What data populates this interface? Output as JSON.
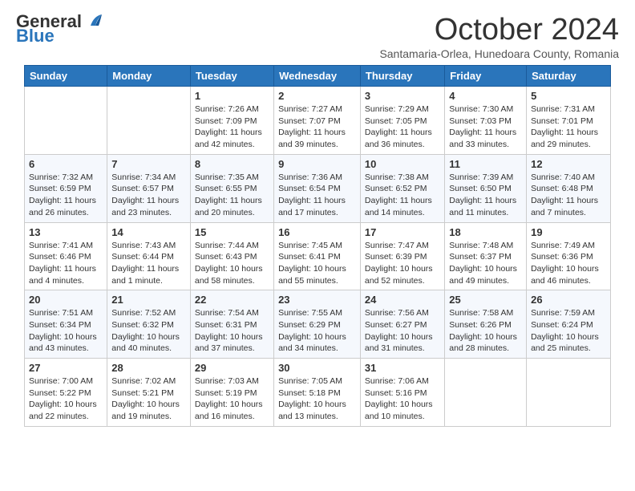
{
  "header": {
    "logo_general": "General",
    "logo_blue": "Blue",
    "title": "October 2024",
    "subtitle": "Santamaria-Orlea, Hunedoara County, Romania"
  },
  "days_of_week": [
    "Sunday",
    "Monday",
    "Tuesday",
    "Wednesday",
    "Thursday",
    "Friday",
    "Saturday"
  ],
  "weeks": [
    [
      {
        "day": "",
        "sunrise": "",
        "sunset": "",
        "daylight": ""
      },
      {
        "day": "",
        "sunrise": "",
        "sunset": "",
        "daylight": ""
      },
      {
        "day": "1",
        "sunrise": "Sunrise: 7:26 AM",
        "sunset": "Sunset: 7:09 PM",
        "daylight": "Daylight: 11 hours and 42 minutes."
      },
      {
        "day": "2",
        "sunrise": "Sunrise: 7:27 AM",
        "sunset": "Sunset: 7:07 PM",
        "daylight": "Daylight: 11 hours and 39 minutes."
      },
      {
        "day": "3",
        "sunrise": "Sunrise: 7:29 AM",
        "sunset": "Sunset: 7:05 PM",
        "daylight": "Daylight: 11 hours and 36 minutes."
      },
      {
        "day": "4",
        "sunrise": "Sunrise: 7:30 AM",
        "sunset": "Sunset: 7:03 PM",
        "daylight": "Daylight: 11 hours and 33 minutes."
      },
      {
        "day": "5",
        "sunrise": "Sunrise: 7:31 AM",
        "sunset": "Sunset: 7:01 PM",
        "daylight": "Daylight: 11 hours and 29 minutes."
      }
    ],
    [
      {
        "day": "6",
        "sunrise": "Sunrise: 7:32 AM",
        "sunset": "Sunset: 6:59 PM",
        "daylight": "Daylight: 11 hours and 26 minutes."
      },
      {
        "day": "7",
        "sunrise": "Sunrise: 7:34 AM",
        "sunset": "Sunset: 6:57 PM",
        "daylight": "Daylight: 11 hours and 23 minutes."
      },
      {
        "day": "8",
        "sunrise": "Sunrise: 7:35 AM",
        "sunset": "Sunset: 6:55 PM",
        "daylight": "Daylight: 11 hours and 20 minutes."
      },
      {
        "day": "9",
        "sunrise": "Sunrise: 7:36 AM",
        "sunset": "Sunset: 6:54 PM",
        "daylight": "Daylight: 11 hours and 17 minutes."
      },
      {
        "day": "10",
        "sunrise": "Sunrise: 7:38 AM",
        "sunset": "Sunset: 6:52 PM",
        "daylight": "Daylight: 11 hours and 14 minutes."
      },
      {
        "day": "11",
        "sunrise": "Sunrise: 7:39 AM",
        "sunset": "Sunset: 6:50 PM",
        "daylight": "Daylight: 11 hours and 11 minutes."
      },
      {
        "day": "12",
        "sunrise": "Sunrise: 7:40 AM",
        "sunset": "Sunset: 6:48 PM",
        "daylight": "Daylight: 11 hours and 7 minutes."
      }
    ],
    [
      {
        "day": "13",
        "sunrise": "Sunrise: 7:41 AM",
        "sunset": "Sunset: 6:46 PM",
        "daylight": "Daylight: 11 hours and 4 minutes."
      },
      {
        "day": "14",
        "sunrise": "Sunrise: 7:43 AM",
        "sunset": "Sunset: 6:44 PM",
        "daylight": "Daylight: 11 hours and 1 minute."
      },
      {
        "day": "15",
        "sunrise": "Sunrise: 7:44 AM",
        "sunset": "Sunset: 6:43 PM",
        "daylight": "Daylight: 10 hours and 58 minutes."
      },
      {
        "day": "16",
        "sunrise": "Sunrise: 7:45 AM",
        "sunset": "Sunset: 6:41 PM",
        "daylight": "Daylight: 10 hours and 55 minutes."
      },
      {
        "day": "17",
        "sunrise": "Sunrise: 7:47 AM",
        "sunset": "Sunset: 6:39 PM",
        "daylight": "Daylight: 10 hours and 52 minutes."
      },
      {
        "day": "18",
        "sunrise": "Sunrise: 7:48 AM",
        "sunset": "Sunset: 6:37 PM",
        "daylight": "Daylight: 10 hours and 49 minutes."
      },
      {
        "day": "19",
        "sunrise": "Sunrise: 7:49 AM",
        "sunset": "Sunset: 6:36 PM",
        "daylight": "Daylight: 10 hours and 46 minutes."
      }
    ],
    [
      {
        "day": "20",
        "sunrise": "Sunrise: 7:51 AM",
        "sunset": "Sunset: 6:34 PM",
        "daylight": "Daylight: 10 hours and 43 minutes."
      },
      {
        "day": "21",
        "sunrise": "Sunrise: 7:52 AM",
        "sunset": "Sunset: 6:32 PM",
        "daylight": "Daylight: 10 hours and 40 minutes."
      },
      {
        "day": "22",
        "sunrise": "Sunrise: 7:54 AM",
        "sunset": "Sunset: 6:31 PM",
        "daylight": "Daylight: 10 hours and 37 minutes."
      },
      {
        "day": "23",
        "sunrise": "Sunrise: 7:55 AM",
        "sunset": "Sunset: 6:29 PM",
        "daylight": "Daylight: 10 hours and 34 minutes."
      },
      {
        "day": "24",
        "sunrise": "Sunrise: 7:56 AM",
        "sunset": "Sunset: 6:27 PM",
        "daylight": "Daylight: 10 hours and 31 minutes."
      },
      {
        "day": "25",
        "sunrise": "Sunrise: 7:58 AM",
        "sunset": "Sunset: 6:26 PM",
        "daylight": "Daylight: 10 hours and 28 minutes."
      },
      {
        "day": "26",
        "sunrise": "Sunrise: 7:59 AM",
        "sunset": "Sunset: 6:24 PM",
        "daylight": "Daylight: 10 hours and 25 minutes."
      }
    ],
    [
      {
        "day": "27",
        "sunrise": "Sunrise: 7:00 AM",
        "sunset": "Sunset: 5:22 PM",
        "daylight": "Daylight: 10 hours and 22 minutes."
      },
      {
        "day": "28",
        "sunrise": "Sunrise: 7:02 AM",
        "sunset": "Sunset: 5:21 PM",
        "daylight": "Daylight: 10 hours and 19 minutes."
      },
      {
        "day": "29",
        "sunrise": "Sunrise: 7:03 AM",
        "sunset": "Sunset: 5:19 PM",
        "daylight": "Daylight: 10 hours and 16 minutes."
      },
      {
        "day": "30",
        "sunrise": "Sunrise: 7:05 AM",
        "sunset": "Sunset: 5:18 PM",
        "daylight": "Daylight: 10 hours and 13 minutes."
      },
      {
        "day": "31",
        "sunrise": "Sunrise: 7:06 AM",
        "sunset": "Sunset: 5:16 PM",
        "daylight": "Daylight: 10 hours and 10 minutes."
      },
      {
        "day": "",
        "sunrise": "",
        "sunset": "",
        "daylight": ""
      },
      {
        "day": "",
        "sunrise": "",
        "sunset": "",
        "daylight": ""
      }
    ]
  ]
}
